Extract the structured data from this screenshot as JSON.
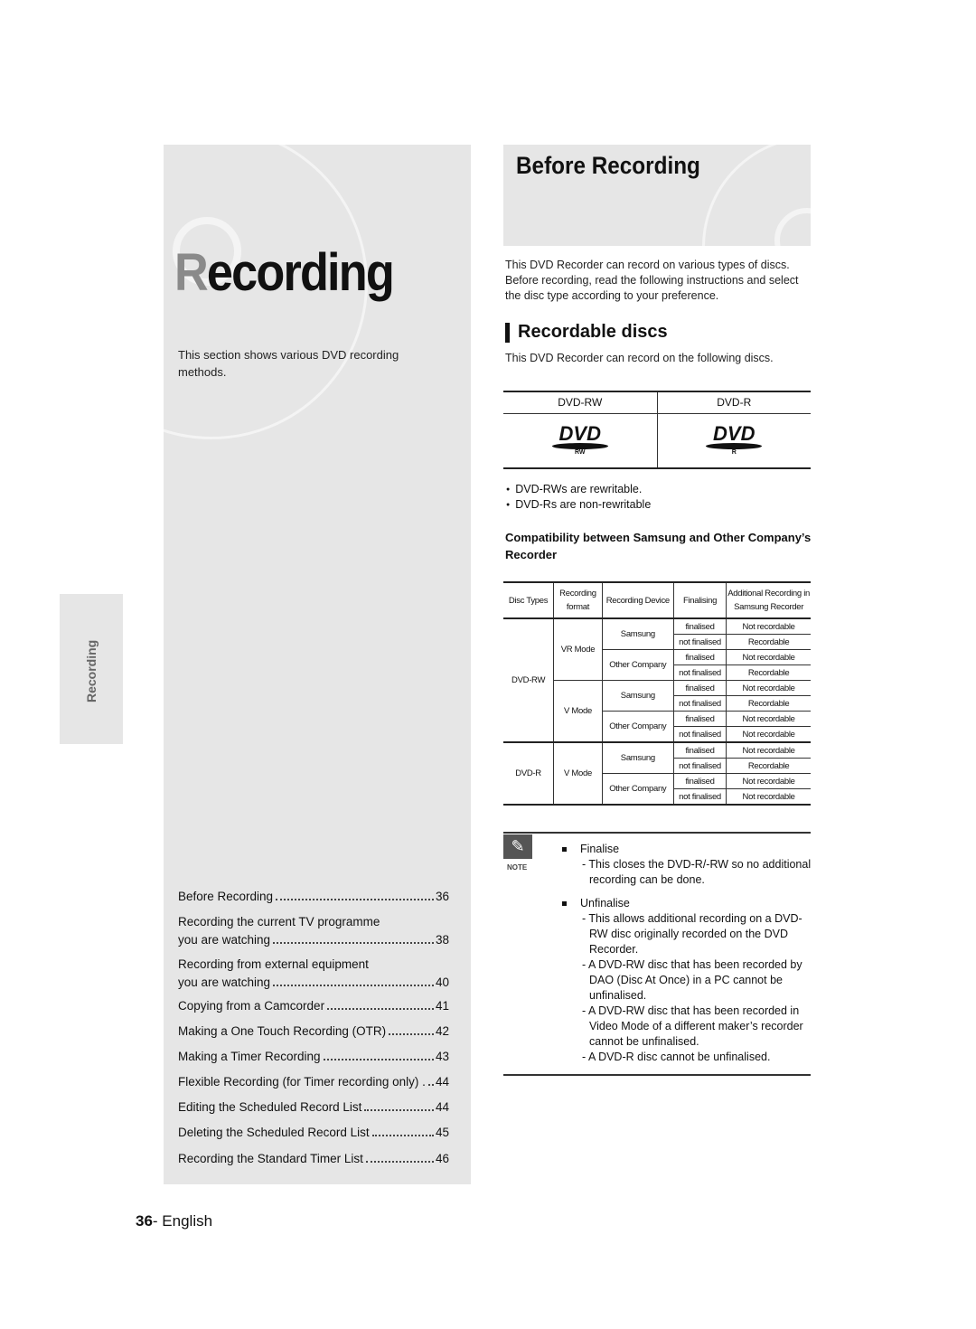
{
  "left": {
    "big_title_first": "R",
    "big_title_rest": "ecording",
    "description": "This section shows various DVD recording methods.",
    "side_tab": "Recording",
    "toc": [
      {
        "lines": [
          "Before Recording"
        ],
        "page": "36"
      },
      {
        "lines": [
          "Recording the current TV programme",
          "you are watching"
        ],
        "page": "38"
      },
      {
        "lines": [
          "Recording from external equipment",
          "you are watching"
        ],
        "page": "40"
      },
      {
        "lines": [
          "Copying from a Camcorder"
        ],
        "page": "41"
      },
      {
        "lines": [
          "Making a One Touch Recording (OTR)"
        ],
        "page": "42"
      },
      {
        "lines": [
          "Making a Timer Recording"
        ],
        "page": "43"
      },
      {
        "lines": [
          "Flexible Recording (for Timer recording only) ."
        ],
        "page": "44"
      },
      {
        "lines": [
          "Editing the Scheduled Record List"
        ],
        "page": "44"
      },
      {
        "lines": [
          "Deleting the Scheduled Record List"
        ],
        "page": "45"
      },
      {
        "lines": [
          "Recording the Standard Timer List"
        ],
        "page": "46"
      }
    ]
  },
  "footer": {
    "page_number": "36",
    "language": "- English"
  },
  "right": {
    "title": "Before Recording",
    "intro": "This DVD Recorder can record on various types of discs. Before recording, read the following instructions and select the disc type according to your preference.",
    "subheading": "Recordable discs",
    "sub_intro": "This DVD Recorder can record on the following discs.",
    "discs": [
      {
        "name": "DVD-RW",
        "logo_text": "DVD",
        "logo_sub": "RW"
      },
      {
        "name": "DVD-R",
        "logo_text": "DVD",
        "logo_sub": "R"
      }
    ],
    "bullets": [
      "DVD-RWs are rewritable.",
      "DVD-Rs are non-rewritable"
    ],
    "compat_heading": "Compatibility between Samsung and Other Company’s Recorder",
    "compat_table": {
      "headers": [
        "Disc Types",
        "Recording format",
        "Recording Device",
        "Finalising",
        "Additional Recording in Samsung Recorder"
      ],
      "groups": [
        {
          "disc": "DVD-RW",
          "formats": [
            {
              "format": "VR Mode",
              "devices": [
                {
                  "device": "Samsung",
                  "rows": [
                    [
                      "finalised",
                      "Not recordable"
                    ],
                    [
                      "not finalised",
                      "Recordable"
                    ]
                  ]
                },
                {
                  "device": "Other Company",
                  "rows": [
                    [
                      "finalised",
                      "Not recordable"
                    ],
                    [
                      "not finalised",
                      "Recordable"
                    ]
                  ]
                }
              ]
            },
            {
              "format": "V Mode",
              "devices": [
                {
                  "device": "Samsung",
                  "rows": [
                    [
                      "finalised",
                      "Not recordable"
                    ],
                    [
                      "not finalised",
                      "Recordable"
                    ]
                  ]
                },
                {
                  "device": "Other Company",
                  "rows": [
                    [
                      "finalised",
                      "Not recordable"
                    ],
                    [
                      "not finalised",
                      "Not recordable"
                    ]
                  ]
                }
              ]
            }
          ]
        },
        {
          "disc": "DVD-R",
          "formats": [
            {
              "format": "V Mode",
              "devices": [
                {
                  "device": "Samsung",
                  "rows": [
                    [
                      "finalised",
                      "Not recordable"
                    ],
                    [
                      "not finalised",
                      "Recordable"
                    ]
                  ]
                },
                {
                  "device": "Other Company",
                  "rows": [
                    [
                      "finalised",
                      "Not recordable"
                    ],
                    [
                      "not finalised",
                      "Not recordable"
                    ]
                  ]
                }
              ]
            }
          ]
        }
      ]
    },
    "note": {
      "label": "NOTE",
      "icon": "pencil-icon",
      "sections": [
        {
          "heading": "Finalise",
          "items": [
            "- This closes the DVD-R/-RW so no additional recording can be done."
          ]
        },
        {
          "heading": "Unfinalise",
          "items": [
            "- This allows additional recording on a DVD-RW disc originally recorded on the DVD Recorder.",
            "- A DVD-RW disc that has been recorded by DAO (Disc At Once) in a PC cannot be unfinalised.",
            "- A DVD-RW disc that has been recorded in Video Mode of a different maker’s recorder cannot be unfinalised.",
            "- A DVD-R disc cannot be unfinalised."
          ]
        }
      ]
    }
  }
}
